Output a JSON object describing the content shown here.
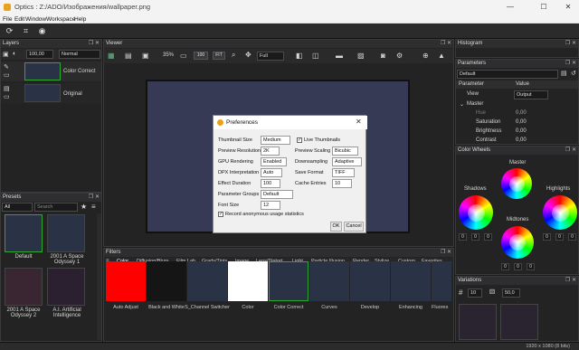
{
  "window": {
    "title": "Optics : Z:/ADO/Изображения/wallpaper.png"
  },
  "menu": [
    "File",
    "Edit",
    "Window",
    "Workspace",
    "Help"
  ],
  "layers": {
    "title": "Layers",
    "opacity": "100,00",
    "blend": "Normal",
    "items": [
      {
        "name": "Color Correct"
      },
      {
        "name": "Original"
      }
    ]
  },
  "presets": {
    "title": "Presets",
    "filter": "All",
    "search_placeholder": "Search",
    "items": [
      {
        "label": "Default"
      },
      {
        "label": "2001 A Space Odyssey 1"
      },
      {
        "label": "2001 A Space Odyssey 2"
      },
      {
        "label": "A.I. Artificial Intelligence"
      }
    ]
  },
  "viewer": {
    "title": "Viewer",
    "zoom": "35%",
    "zoom100": "100",
    "fit": "FIT",
    "mode": "Full"
  },
  "histogram": {
    "title": "Histogram"
  },
  "parameters": {
    "title": "Parameters",
    "preset": "Default",
    "col_param": "Parameter",
    "col_value": "Value",
    "rows": [
      {
        "name": "View",
        "value": "Output"
      },
      {
        "name": "Master",
        "value": ""
      },
      {
        "name": "Hue",
        "value": "0,00"
      },
      {
        "name": "Saturation",
        "value": "0,00"
      },
      {
        "name": "Brightness",
        "value": "0,00"
      },
      {
        "name": "Contrast",
        "value": "0,00"
      }
    ]
  },
  "wheels": {
    "title": "Color Wheels",
    "master": "Master",
    "shadows": "Shadows",
    "highlights": "Highlights",
    "midtones": "Midtones",
    "zero": "0"
  },
  "filters": {
    "title": "Filters",
    "tabs": [
      "Color",
      "Diffusion/Blurs",
      "Film Lab",
      "Grads/Tints",
      "Image",
      "Lens/Distort",
      "Light",
      "Particle Illusion",
      "Render",
      "Stylize",
      "Custom",
      "Favorites"
    ],
    "items": [
      "Auto Adjust",
      "Black and White",
      "S_Channel Switcher",
      "Color",
      "Color Correct",
      "Curves",
      "Develop",
      "Enhancing",
      "Fluores"
    ]
  },
  "variations": {
    "title": "Variations",
    "count": "10",
    "amount": "50,0"
  },
  "status": {
    "text": "1920 x 1080 (8 bits)"
  },
  "dialog": {
    "title": "Preferences",
    "thumb_size_label": "Thumbnail Size",
    "thumb_size": "Medium",
    "live_thumbs": "Live Thumbnails",
    "prev_res_label": "Preview Resolution",
    "prev_res": "2K",
    "prev_scaling_label": "Preview Scaling",
    "prev_scaling": "Bicubic",
    "gpu_label": "GPU Rendering",
    "gpu": "Enabled",
    "down_label": "Downsampling",
    "down": "Adaptive",
    "dpx_label": "DPX Interpretation",
    "dpx": "Auto",
    "save_fmt_label": "Save Format",
    "save_fmt": "TIFF",
    "effect_label": "Effect Duration",
    "effect": "100",
    "cache_label": "Cache Entries",
    "cache": "10",
    "param_groups_label": "Parameter Groups",
    "param_groups": "Default",
    "font_label": "Font Size",
    "font": "12",
    "record": "Record anonymous usage statistics",
    "ok": "OK",
    "cancel": "Cancel"
  },
  "colors": {
    "accent": "#2ea82e",
    "bg": "#232324",
    "canvas": "#363a55"
  }
}
